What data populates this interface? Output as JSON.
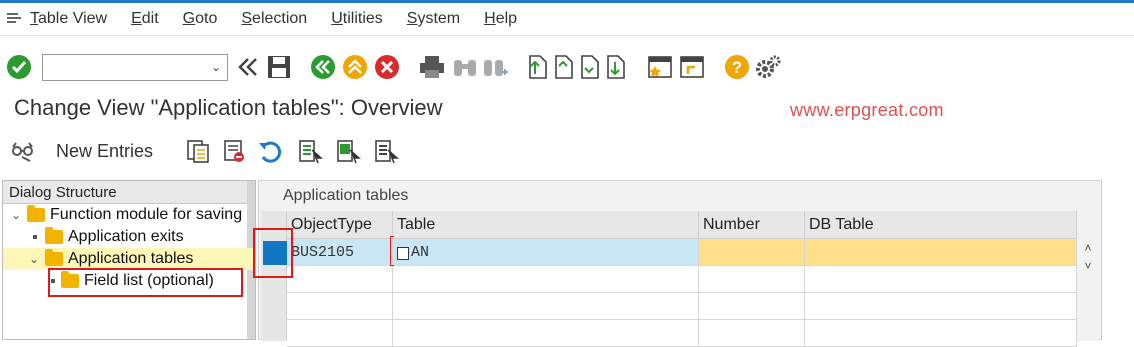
{
  "menu": {
    "items": [
      "Table View",
      "Edit",
      "Goto",
      "Selection",
      "Utilities",
      "System",
      "Help"
    ],
    "underline": [
      "T",
      "E",
      "G",
      "S",
      "U",
      "S",
      "H"
    ]
  },
  "page": {
    "title": "Change View \"Application tables\": Overview",
    "watermark": "www.erpgreat.com"
  },
  "app_toolbar": {
    "new_entries": "New Entries"
  },
  "dialog_structure": {
    "header": "Dialog Structure",
    "items": [
      {
        "label": "Function module for saving"
      },
      {
        "label": "Application exits"
      },
      {
        "label": "Application tables"
      },
      {
        "label": "Field list (optional)"
      }
    ]
  },
  "table": {
    "title": "Application tables",
    "columns": [
      "ObjectType",
      "Table",
      "Number",
      "DB Table"
    ],
    "rows": [
      [
        "BUS2105",
        "AN",
        "",
        ""
      ]
    ]
  },
  "colors": {
    "accent": "#1e7ac6",
    "selected_row": "#c8e6f4",
    "input_cell": "#fde089",
    "highlight_box": "#e01818"
  }
}
